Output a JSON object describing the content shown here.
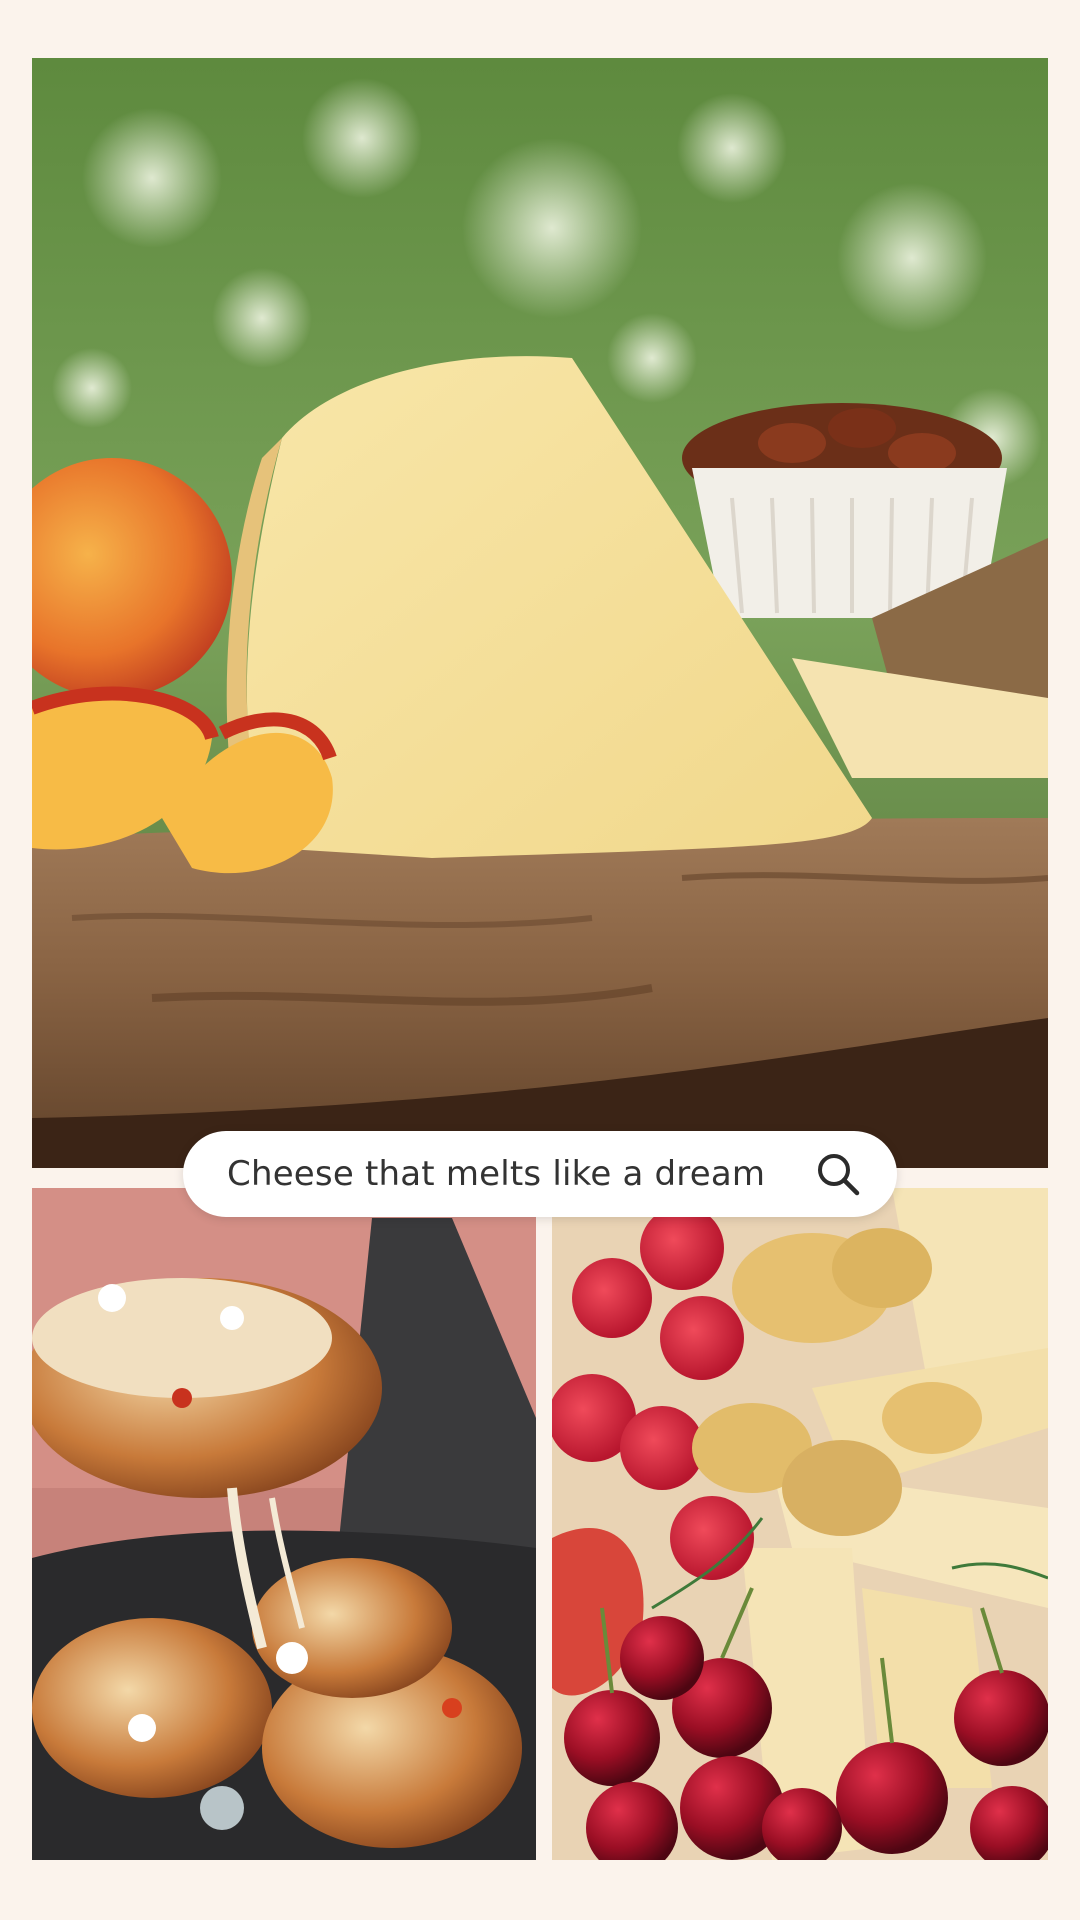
{
  "search": {
    "query": "Cheese that melts like a dream",
    "icon": "search-icon"
  },
  "images": [
    {
      "name": "hero-photo",
      "subject": "cheese wedge on wooden board with peaches, almonds and crackers"
    },
    {
      "name": "melt-photo",
      "subject": "grilled peaches with melting cheese in cast-iron skillet"
    },
    {
      "name": "platter-photo",
      "subject": "cheese slices with raspberries, cherries and chips"
    }
  ],
  "colors": {
    "background": "#fbf3ec",
    "search_bg": "#ffffff",
    "search_text": "#333333"
  }
}
